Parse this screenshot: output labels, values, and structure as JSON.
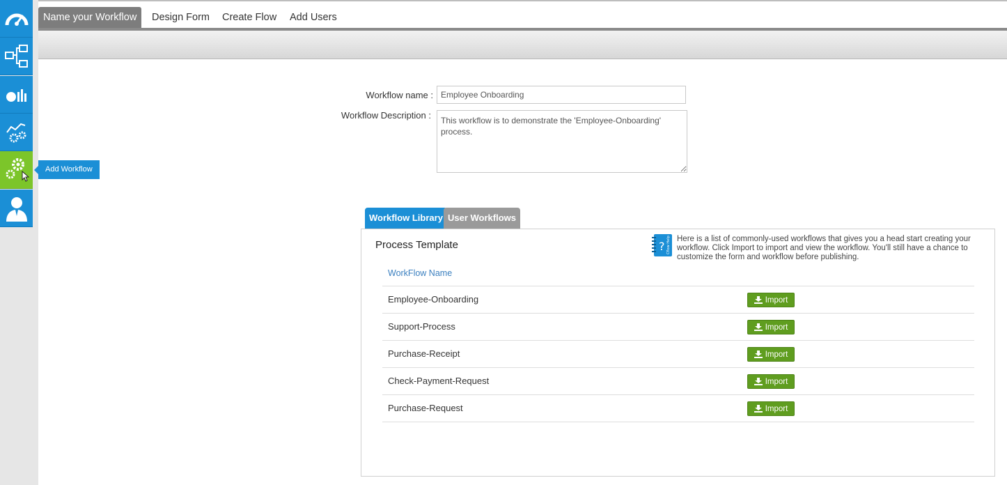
{
  "top_tabs": [
    {
      "label": "Name your Workflow",
      "active": true
    },
    {
      "label": "Design Form",
      "active": false
    },
    {
      "label": "Create Flow",
      "active": false
    },
    {
      "label": "Add Users",
      "active": false
    }
  ],
  "sidebar": {
    "items": [
      {
        "icon": "dashboard-icon"
      },
      {
        "icon": "workflow-diagram-icon"
      },
      {
        "icon": "reports-icon"
      },
      {
        "icon": "workflow-settings-icon"
      },
      {
        "icon": "add-workflow-gears-icon",
        "active": true
      },
      {
        "icon": "user-icon"
      }
    ],
    "tooltip": "Add Workflow"
  },
  "form": {
    "name_label": "Workflow name :",
    "name_value": "Employee Onboarding",
    "desc_label": "Workflow Description :",
    "desc_value": "This workflow is to demonstrate the 'Employee-Onboarding' process."
  },
  "library": {
    "tabs": [
      {
        "label": "Workflow Library",
        "active": true
      },
      {
        "label": "User Workflows",
        "active": false
      }
    ],
    "title": "Process Template",
    "help_icon_text": "Cflow Help",
    "help_text": "Here is a list of commonly-used workflows that gives you a head start creating your workflow. Click Import to import and view the workflow. You'll still have a chance to customize the form and workflow before publishing.",
    "column_header": "WorkFlow Name",
    "import_label": "Import",
    "rows": [
      "Employee-Onboarding",
      "Support-Process",
      "Purchase-Receipt",
      "Check-Payment-Request",
      "Purchase-Request"
    ]
  },
  "colors": {
    "sidebar_blue": "#1b8fd6",
    "sidebar_active_green": "#7cc52a",
    "import_green": "#5f9d1f",
    "active_tab_gray": "#7d7d7d"
  }
}
